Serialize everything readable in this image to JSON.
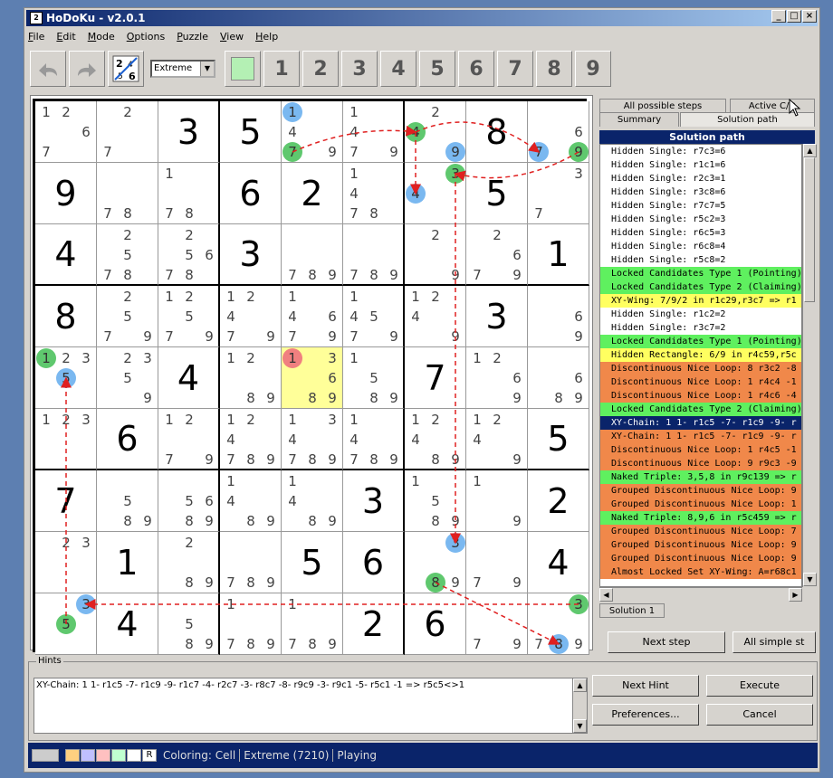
{
  "window": {
    "title": "HoDoKu - v2.0.1"
  },
  "menu": [
    "File",
    "Edit",
    "Mode",
    "Options",
    "Puzzle",
    "View",
    "Help"
  ],
  "toolbar": {
    "level": "Extreme",
    "numbers": [
      "1",
      "2",
      "3",
      "4",
      "5",
      "6",
      "7",
      "8",
      "9"
    ],
    "icons": [
      "undo-icon",
      "redo-icon",
      "candidates-toggle-icon",
      "color-filter-icon"
    ]
  },
  "colors": {
    "accent": "#0a246a",
    "cand_blue": "#7ab8f0",
    "cand_green": "#5fc86e",
    "cand_red": "#f08080",
    "selected_cell": "#ffff99"
  },
  "board": [
    [
      {
        "c": "1 2 . . . 6 7 . ."
      },
      {
        "c": ". 2 . . . . 7 . ."
      },
      {
        "v": "3"
      },
      {
        "v": "5"
      },
      {
        "c": "1 . . 4 . . 7 . 9"
      },
      {
        "c": "1 . . 4 . . 7 . 9"
      },
      {
        "c": ". 2 . 4 . . . . ."
      },
      {
        "v": "8"
      },
      {
        "c": ". . . . . 6 7 . 9"
      }
    ],
    [
      {
        "v": "9"
      },
      {
        "c": ". . . . . . 7 8 ."
      },
      {
        "c": "1 . . . . . 7 8 ."
      },
      {
        "v": "6"
      },
      {
        "v": "2"
      },
      {
        "c": "1 . . 4 . . 7 8 ."
      },
      {
        "c": ". . 3 4 . . . . ."
      },
      {
        "v": "5"
      },
      {
        "c": ". . 3 . . . 7 . ."
      }
    ],
    [
      {
        "v": "4"
      },
      {
        "c": ". 2 . . 5 . 7 8 ."
      },
      {
        "c": ". 2 . . 5 6 7 8 ."
      },
      {
        "v": "3"
      },
      {
        "c": ". . . . . . 7 8 9"
      },
      {
        "c": ". . . . . . 7 8 9"
      },
      {
        "c": ". 2 . . . . . . 9"
      },
      {
        "c": ". 2 . . . 6 7 . 9"
      },
      {
        "v": "1"
      }
    ],
    [
      {
        "v": "8"
      },
      {
        "c": ". 2 . . 5 . 7 . 9"
      },
      {
        "c": "1 2 . . 5 . 7 . 9"
      },
      {
        "c": "1 2 . 4 . . 7 . 9"
      },
      {
        "c": "1 . . 4 . 6 7 . 9"
      },
      {
        "c": "1 . . 4 5 . 7 . 9"
      },
      {
        "c": "1 2 . 4 . . . . 9"
      },
      {
        "v": "3"
      },
      {
        "c": ". . . . . 6 . . 9"
      }
    ],
    [
      {
        "c": "1 2 3 . 5 . . . ."
      },
      {
        "c": ". 2 3 . 5 . . . 9"
      },
      {
        "v": "4"
      },
      {
        "c": "1 2 . . . . . 8 9"
      },
      {
        "c": "1 . 3 . . 6 . 8 9"
      },
      {
        "c": "1 . . . 5 . . 8 9"
      },
      {
        "v": "7"
      },
      {
        "c": "1 2 . . . 6 . . 9"
      },
      {
        "c": ". . . . . 6 . 8 9"
      }
    ],
    [
      {
        "c": "1 2 3 . . . . . ."
      },
      {
        "v": "6"
      },
      {
        "c": "1 2 . . . . 7 . 9"
      },
      {
        "c": "1 2 . 4 . . 7 8 9"
      },
      {
        "c": "1 . 3 4 . . 7 8 9"
      },
      {
        "c": "1 . . 4 . . 7 8 9"
      },
      {
        "c": "1 2 . 4 . . . 8 9"
      },
      {
        "c": "1 2 . 4 . . . . 9"
      },
      {
        "v": "5"
      }
    ],
    [
      {
        "v": "7"
      },
      {
        "c": ". . . . 5 . . 8 9"
      },
      {
        "c": ". . . . 5 6 . 8 9"
      },
      {
        "c": "1 . . 4 . . . 8 9"
      },
      {
        "c": "1 . . 4 . . . 8 9"
      },
      {
        "v": "3"
      },
      {
        "c": "1 . . . 5 . . 8 9"
      },
      {
        "c": "1 . . . . . . . 9"
      },
      {
        "v": "2"
      }
    ],
    [
      {
        "c": ". 2 3 . . . . . ."
      },
      {
        "v": "1"
      },
      {
        "c": ". 2 . . . . . 8 9"
      },
      {
        "c": ". . . . . . 7 8 9"
      },
      {
        "v": "5"
      },
      {
        "v": "6"
      },
      {
        "c": ". . 3 . . . . 8 9"
      },
      {
        "c": ". . . . . . 7 . 9"
      },
      {
        "v": "4"
      }
    ],
    [
      {
        "c": ". . 3 . 5 . . . ."
      },
      {
        "v": "4"
      },
      {
        "c": ". . . . 5 . . 8 9"
      },
      {
        "c": "1 . . . . . 7 8 9"
      },
      {
        "c": "1 . . . . . 7 8 9"
      },
      {
        "v": "2"
      },
      {
        "v": "6"
      },
      {
        "c": ". . . . . . 7 . 9"
      },
      {
        "c": ". . 3 . . . 7 8 9"
      }
    ]
  ],
  "highlights": [
    {
      "r": 0,
      "col": 4,
      "d": "1",
      "t": "b"
    },
    {
      "r": 0,
      "col": 4,
      "d": "7",
      "t": "g"
    },
    {
      "r": 0,
      "col": 6,
      "d": "4",
      "t": "g"
    },
    {
      "r": 0,
      "col": 6,
      "d": "9",
      "t": "b"
    },
    {
      "r": 0,
      "col": 8,
      "d": "7",
      "t": "b"
    },
    {
      "r": 0,
      "col": 8,
      "d": "9",
      "t": "g"
    },
    {
      "r": 1,
      "col": 6,
      "d": "3",
      "t": "g"
    },
    {
      "r": 1,
      "col": 6,
      "d": "4",
      "t": "b"
    },
    {
      "r": 4,
      "col": 0,
      "d": "1",
      "t": "g"
    },
    {
      "r": 4,
      "col": 0,
      "d": "5",
      "t": "b"
    },
    {
      "r": 4,
      "col": 4,
      "d": "1",
      "t": "r"
    },
    {
      "r": 7,
      "col": 6,
      "d": "3",
      "t": "b"
    },
    {
      "r": 7,
      "col": 6,
      "d": "8",
      "t": "g"
    },
    {
      "r": 8,
      "col": 0,
      "d": "3",
      "t": "b"
    },
    {
      "r": 8,
      "col": 0,
      "d": "5",
      "t": "g"
    },
    {
      "r": 8,
      "col": 8,
      "d": "3",
      "t": "g"
    },
    {
      "r": 8,
      "col": 8,
      "d": "8",
      "t": "b"
    }
  ],
  "tabs": {
    "row1": [
      "All possible steps",
      "Active C/D"
    ],
    "row2": [
      "Summary",
      "Solution path"
    ],
    "bottom": "Solution 1"
  },
  "solution_header": "Solution path",
  "steps": [
    {
      "t": "Hidden Single: r7c3=6",
      "bg": "#fff"
    },
    {
      "t": "Hidden Single: r1c1=6",
      "bg": "#fff"
    },
    {
      "t": "Hidden Single: r2c3=1",
      "bg": "#fff"
    },
    {
      "t": "Hidden Single: r3c8=6",
      "bg": "#fff"
    },
    {
      "t": "Hidden Single: r7c7=5",
      "bg": "#fff"
    },
    {
      "t": "Hidden Single: r5c2=3",
      "bg": "#fff"
    },
    {
      "t": "Hidden Single: r6c5=3",
      "bg": "#fff"
    },
    {
      "t": "Hidden Single: r6c8=4",
      "bg": "#fff"
    },
    {
      "t": "Hidden Single: r5c8=2",
      "bg": "#fff"
    },
    {
      "t": "Locked Candidates Type 1 (Pointing)",
      "bg": "#5ff05f"
    },
    {
      "t": "Locked Candidates Type 2 (Claiming)",
      "bg": "#5ff05f"
    },
    {
      "t": "XY-Wing: 7/9/2 in r1c29,r3c7 => r1",
      "bg": "#ffff60"
    },
    {
      "t": "Hidden Single: r1c2=2",
      "bg": "#fff"
    },
    {
      "t": "Hidden Single: r3c7=2",
      "bg": "#fff"
    },
    {
      "t": "Locked Candidates Type 1 (Pointing)",
      "bg": "#5ff05f"
    },
    {
      "t": "Hidden Rectangle: 6/9 in r4c59,r5c",
      "bg": "#ffff60"
    },
    {
      "t": "Discontinuous Nice Loop: 8 r3c2 -8",
      "bg": "#f0884a"
    },
    {
      "t": "Discontinuous Nice Loop: 1 r4c4 -1",
      "bg": "#f0884a"
    },
    {
      "t": "Discontinuous Nice Loop: 1 r4c6 -4",
      "bg": "#f0884a"
    },
    {
      "t": "Locked Candidates Type 2 (Claiming)",
      "bg": "#5ff05f"
    },
    {
      "t": "XY-Chain: 1 1- r1c5 -7- r1c9 -9- r",
      "bg": "#0a246a",
      "fg": "#fff"
    },
    {
      "t": "XY-Chain: 1 1- r1c5 -7- r1c9 -9- r",
      "bg": "#f0884a"
    },
    {
      "t": "Discontinuous Nice Loop: 1 r4c5 -1",
      "bg": "#f0884a"
    },
    {
      "t": "Discontinuous Nice Loop: 9 r9c3 -9",
      "bg": "#f0884a"
    },
    {
      "t": "Naked Triple: 3,5,8 in r9c139 => r",
      "bg": "#5ff05f"
    },
    {
      "t": "Grouped Discontinuous Nice Loop: 9",
      "bg": "#f0884a"
    },
    {
      "t": "Grouped Discontinuous Nice Loop: 1",
      "bg": "#f0884a"
    },
    {
      "t": "Naked Triple: 8,9,6 in r5c459 => r",
      "bg": "#5ff05f"
    },
    {
      "t": "Grouped Discontinuous Nice Loop: 7",
      "bg": "#f0884a"
    },
    {
      "t": "Grouped Discontinuous Nice Loop: 9",
      "bg": "#f0884a"
    },
    {
      "t": "Grouped Discontinuous Nice Loop: 9",
      "bg": "#f0884a"
    },
    {
      "t": "Almost Locked Set XY-Wing: A=r68c1",
      "bg": "#f0884a"
    }
  ],
  "buttons": {
    "next_step": "Next step",
    "all_simple": "All simple st",
    "next_hint": "Next Hint",
    "execute": "Execute",
    "preferences": "Preferences...",
    "cancel": "Cancel"
  },
  "hints": {
    "label": "Hints",
    "text": "XY-Chain: 1 1- r1c5 -7- r1c9 -9- r1c7 -4- r2c7 -3- r8c7 -8- r9c9 -3- r9c1 -5- r5c1 -1 => r5c5<>1"
  },
  "status": {
    "swatch_letter": "R",
    "coloring": "Coloring: Cell",
    "level": "Extreme (7210)",
    "state": "Playing"
  }
}
